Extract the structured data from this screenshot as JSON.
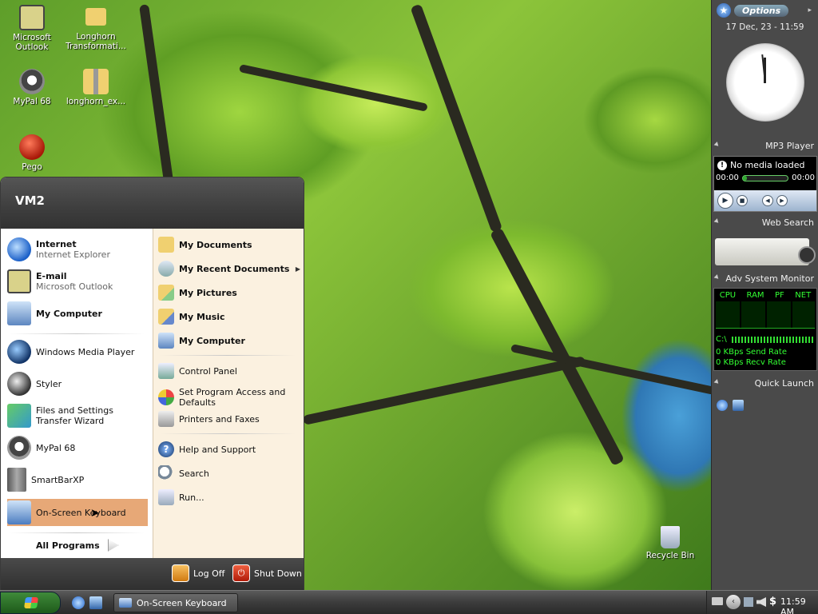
{
  "desktop": {
    "icons": [
      {
        "label": "Microsoft Outlook"
      },
      {
        "label": "Longhorn Transformati..."
      },
      {
        "label": "MyPal 68"
      },
      {
        "label": "longhorn_ex..."
      },
      {
        "label": "Pego"
      },
      {
        "label": "Recycle Bin"
      }
    ]
  },
  "sidebar": {
    "options_label": "Options",
    "date_time": "17 Dec, 23 - 11:59",
    "mp3": {
      "title": "MP3 Player",
      "status": "No media loaded",
      "time_left": "00:00",
      "time_right": "00:00",
      "progress": 0.1
    },
    "web_search": {
      "title": "Web Search"
    },
    "monitor": {
      "title": "Adv System Monitor",
      "columns": [
        "CPU",
        "RAM",
        "PF",
        "NET"
      ],
      "drive": "C:\\",
      "send_rate": "0 KBps Send Rate",
      "recv_rate": "0 KBps Recv Rate"
    },
    "quick_launch": {
      "title": "Quick Launch"
    }
  },
  "start_menu": {
    "user": "VM2",
    "left_items": [
      {
        "title": "Internet",
        "sub": "Internet Explorer"
      },
      {
        "title": "E-mail",
        "sub": "Microsoft Outlook"
      },
      {
        "title": "My Computer",
        "sub": ""
      },
      {
        "title": "Windows Media Player"
      },
      {
        "title": "Styler"
      },
      {
        "title": "Files and Settings Transfer Wizard"
      },
      {
        "title": "MyPal 68"
      },
      {
        "title": "SmartBarXP"
      },
      {
        "title": "On-Screen Keyboard"
      }
    ],
    "all_programs": "All Programs",
    "right_items": [
      {
        "title": "My Documents"
      },
      {
        "title": "My Recent Documents"
      },
      {
        "title": "My Pictures"
      },
      {
        "title": "My Music"
      },
      {
        "title": "My Computer"
      },
      {
        "title": "Control Panel"
      },
      {
        "title": "Set Program Access and Defaults"
      },
      {
        "title": "Printers and Faxes"
      },
      {
        "title": "Help and Support"
      },
      {
        "title": "Search"
      },
      {
        "title": "Run..."
      }
    ],
    "log_off": "Log Off",
    "shut_down": "Shut Down"
  },
  "taskbar": {
    "task_label": "On-Screen Keyboard",
    "clock": "11:59 AM"
  }
}
